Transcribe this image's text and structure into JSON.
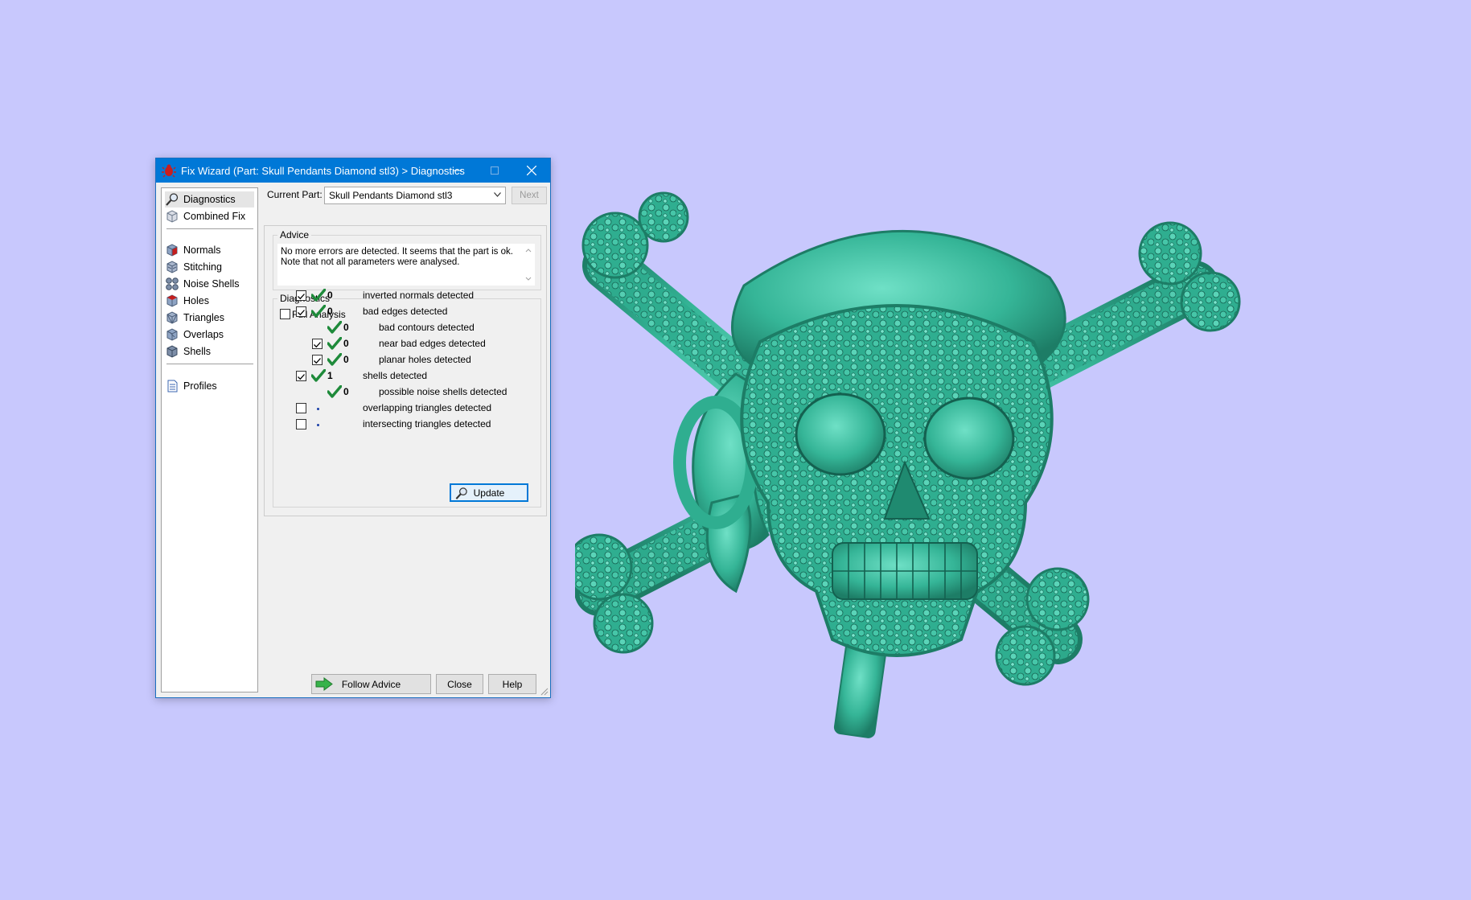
{
  "colors": {
    "desktop": "#c8c8fd",
    "titlebar": "#0078d7",
    "model": "#3bbda0",
    "check": "#1e8a3a"
  },
  "window": {
    "title": "Fix Wizard (Part: Skull Pendants Diamond stl3) > Diagnostics",
    "app_icon": "red-bug-icon"
  },
  "nav": {
    "items": [
      {
        "label": "Diagnostics",
        "icon": "magnifier-icon"
      },
      {
        "label": "Combined Fix",
        "icon": "cube-icon"
      },
      {
        "label": "Normals",
        "icon": "normals-icon"
      },
      {
        "label": "Stitching",
        "icon": "stitching-icon"
      },
      {
        "label": "Noise Shells",
        "icon": "noise-shells-icon"
      },
      {
        "label": "Holes",
        "icon": "holes-icon"
      },
      {
        "label": "Triangles",
        "icon": "triangles-icon"
      },
      {
        "label": "Overlaps",
        "icon": "overlaps-icon"
      },
      {
        "label": "Shells",
        "icon": "shells-icon"
      },
      {
        "label": "Profiles",
        "icon": "document-icon"
      }
    ],
    "selected": "Diagnostics"
  },
  "current_part": {
    "label": "Current Part:",
    "value": "Skull Pendants Diamond stl3",
    "next_label": "Next"
  },
  "advice": {
    "title": "Advice",
    "line1": "No more errors are detected. It seems that the part is ok.",
    "line2": "Note that not all parameters were analysed."
  },
  "diagnostics": {
    "title": "Diagnostics",
    "full_analysis_label": "Full Analysis",
    "full_analysis_checked": false,
    "rows": [
      {
        "label": "inverted normals detected",
        "count": "0",
        "checked": true,
        "has_checkbox": true,
        "indent": 0,
        "status": "ok"
      },
      {
        "label": "bad edges detected",
        "count": "0",
        "checked": true,
        "has_checkbox": true,
        "indent": 0,
        "status": "ok"
      },
      {
        "label": "bad contours detected",
        "count": "0",
        "checked": false,
        "has_checkbox": false,
        "indent": 1,
        "status": "ok"
      },
      {
        "label": "near bad edges detected",
        "count": "0",
        "checked": true,
        "has_checkbox": true,
        "indent": 1,
        "status": "ok"
      },
      {
        "label": "planar holes detected",
        "count": "0",
        "checked": true,
        "has_checkbox": true,
        "indent": 1,
        "status": "ok"
      },
      {
        "label": "shells detected",
        "count": "1",
        "checked": true,
        "has_checkbox": true,
        "indent": 0,
        "status": "ok"
      },
      {
        "label": "possible noise shells detected",
        "count": "0",
        "checked": false,
        "has_checkbox": false,
        "indent": 1,
        "status": "ok"
      },
      {
        "label": "overlapping triangles detected",
        "count": "",
        "checked": false,
        "has_checkbox": true,
        "indent": 0,
        "status": "pending"
      },
      {
        "label": "intersecting triangles detected",
        "count": "",
        "checked": false,
        "has_checkbox": true,
        "indent": 0,
        "status": "pending"
      }
    ],
    "update_label": "Update"
  },
  "footer": {
    "follow_label": "Follow Advice",
    "close_label": "Close",
    "help_label": "Help"
  }
}
